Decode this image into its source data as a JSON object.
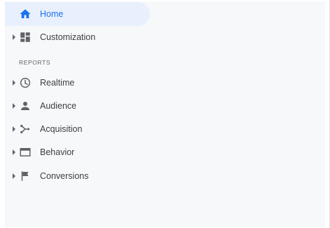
{
  "nav": {
    "home": {
      "label": "Home",
      "icon": "home-icon"
    },
    "customization": {
      "label": "Customization",
      "icon": "dashboard-icon"
    },
    "reports_title": "REPORTS",
    "realtime": {
      "label": "Realtime",
      "icon": "clock-icon"
    },
    "audience": {
      "label": "Audience",
      "icon": "person-icon"
    },
    "acquisition": {
      "label": "Acquisition",
      "icon": "acquisition-icon"
    },
    "behavior": {
      "label": "Behavior",
      "icon": "browser-window-icon"
    },
    "conversions": {
      "label": "Conversions",
      "icon": "flag-icon"
    }
  },
  "colors": {
    "active_bg": "#e8f0fe",
    "active_text": "#1a73e8",
    "text": "#3c4043",
    "icon": "#5f6368",
    "sidebar_bg": "#f7f8fa"
  }
}
